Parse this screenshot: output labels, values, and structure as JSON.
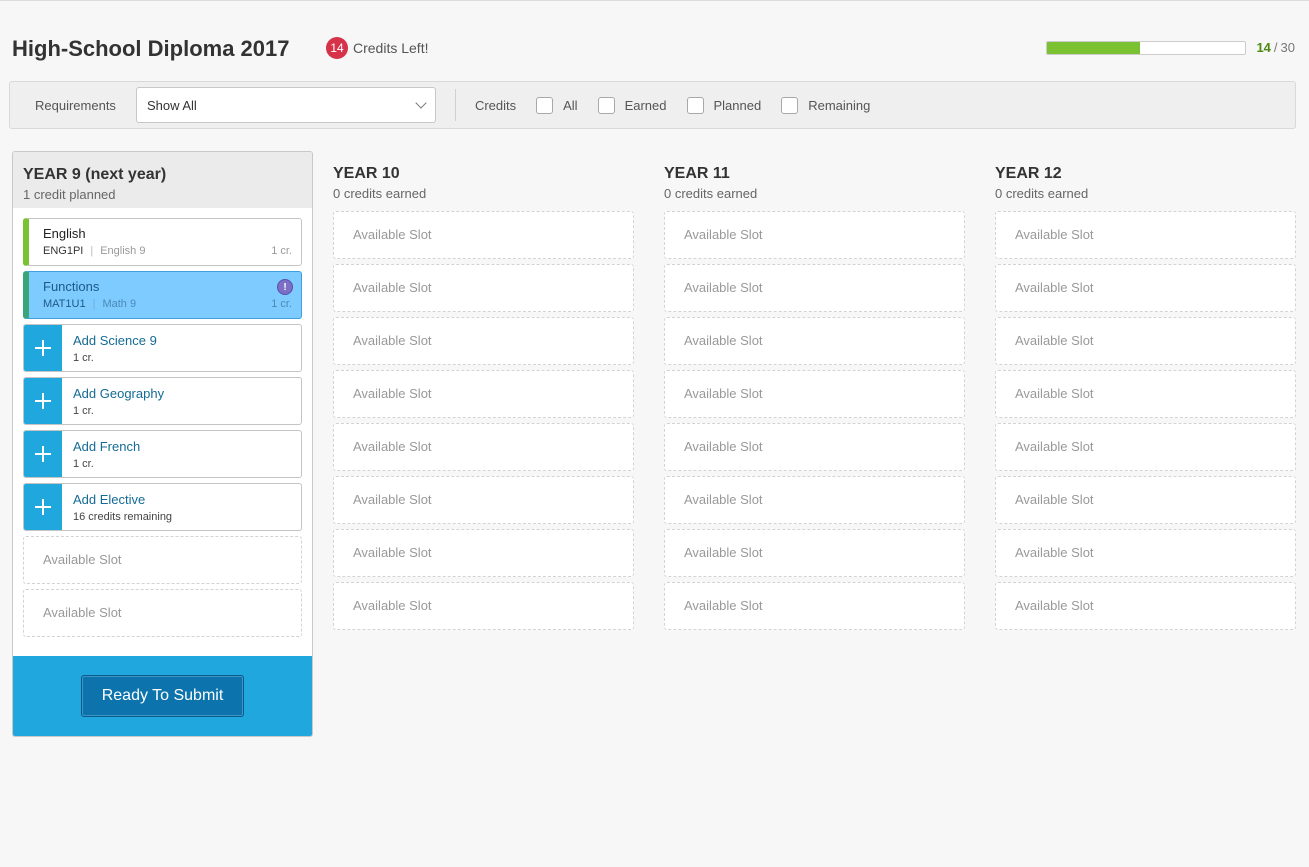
{
  "header": {
    "title": "High-School Diploma 2017",
    "credits_left_count": "14",
    "credits_left_label": "Credits Left!",
    "progress_fraction": 0.4667,
    "progress_count": "14",
    "progress_sep": "/",
    "progress_total": "30"
  },
  "filters": {
    "requirements_label": "Requirements",
    "requirements_value": "Show All",
    "credits_label": "Credits",
    "checkboxes": [
      "All",
      "Earned",
      "Planned",
      "Remaining"
    ]
  },
  "colors": {
    "accent_blue": "#20a7dd",
    "progress_green": "#7ac231",
    "badge_red": "#d6334a",
    "selected_blue": "#7dcbff"
  },
  "year9": {
    "title": "YEAR 9 (next year)",
    "subtitle": "1 credit planned",
    "courses": [
      {
        "name": "English",
        "code": "ENG1PI",
        "subject": "English 9",
        "credits": "1 cr."
      },
      {
        "name": "Functions",
        "code": "MAT1U1",
        "subject": "Math 9",
        "credits": "1 cr.",
        "warning": "!"
      }
    ],
    "adds": [
      {
        "name": "Add Science 9",
        "sub": "1 cr."
      },
      {
        "name": "Add Geography",
        "sub": "1 cr."
      },
      {
        "name": "Add French",
        "sub": "1 cr."
      },
      {
        "name": "Add Elective",
        "sub": "16 credits remaining"
      }
    ],
    "empty_slot_label": "Available Slot",
    "submit_label": "Ready To Submit"
  },
  "years": [
    {
      "title": "YEAR 10",
      "subtitle": "0 credits earned",
      "slot_label": "Available Slot"
    },
    {
      "title": "YEAR 11",
      "subtitle": "0 credits earned",
      "slot_label": "Available Slot"
    },
    {
      "title": "YEAR 12",
      "subtitle": "0 credits earned",
      "slot_label": "Available Slot"
    }
  ]
}
